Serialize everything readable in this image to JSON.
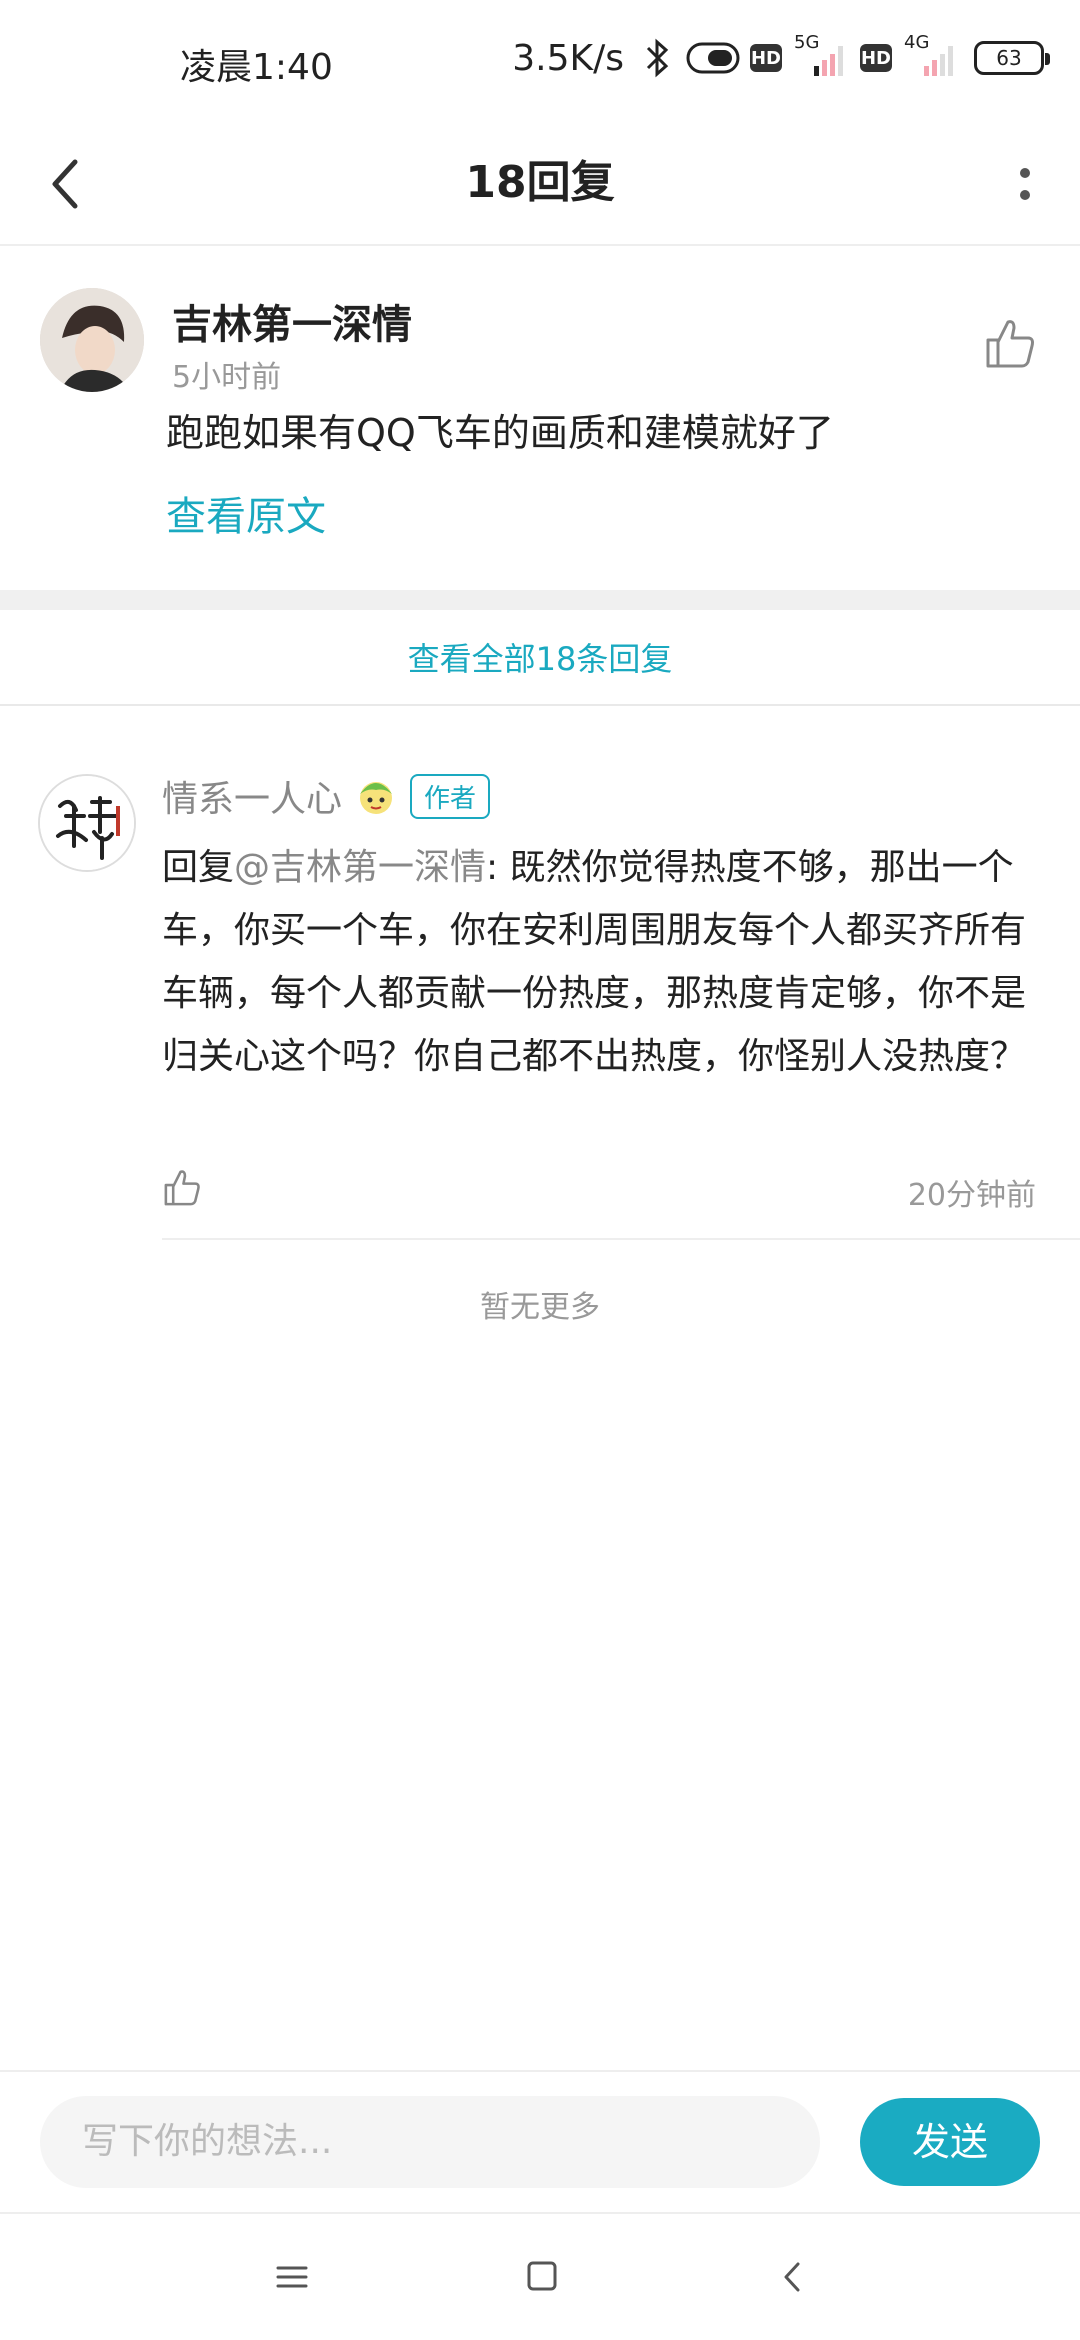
{
  "status_bar": {
    "time": "凌晨1:40",
    "net_speed": "3.5K/s",
    "hd_label": "HD",
    "sig1_gen": "5G",
    "sig2_gen": "4G",
    "battery": "63"
  },
  "header": {
    "title": "18回复"
  },
  "original_comment": {
    "username": "吉林第一深情",
    "time": "5小时前",
    "text": "跑跑如果有QQ飞车的画质和建模就好了",
    "view_original": "查看原文"
  },
  "view_all_replies": "查看全部18条回复",
  "reply": {
    "username": "情系一人心",
    "badge": "作者",
    "prefix": "回复",
    "mention": "@吉林第一深情",
    "text": ": 既然你觉得热度不够，那出一个车，你买一个车，你在安利周围朋友每个人都买齐所有车辆，每个人都贡献一份热度，那热度肯定够，你不是归关心这个吗？你自己都不出热度，你怪别人没热度？",
    "time": "20分钟前"
  },
  "no_more": "暂无更多",
  "input": {
    "placeholder": "写下你的想法...",
    "send_label": "发送"
  },
  "colors": {
    "accent": "#1aa9c0",
    "send_bg": "#1aabc2"
  }
}
